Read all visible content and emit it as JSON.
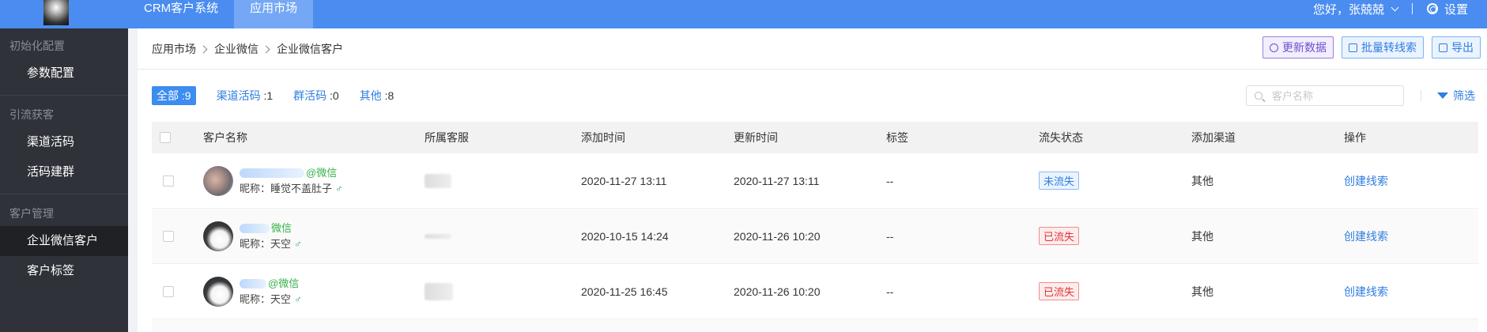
{
  "topbar": {
    "nav": [
      {
        "label": "CRM客户系统",
        "active": false
      },
      {
        "label": "应用市场",
        "active": true
      }
    ],
    "greeting": "您好，张兢兢",
    "settings_label": "设置"
  },
  "sidebar": {
    "groups": [
      {
        "title": "初始化配置",
        "items": [
          {
            "label": "参数配置",
            "active": false
          }
        ]
      },
      {
        "title": "引流获客",
        "items": [
          {
            "label": "渠道活码",
            "active": false
          },
          {
            "label": "活码建群",
            "active": false
          }
        ]
      },
      {
        "title": "客户管理",
        "items": [
          {
            "label": "企业微信客户",
            "active": true
          },
          {
            "label": "客户标签",
            "active": false
          }
        ]
      }
    ]
  },
  "breadcrumb": [
    "应用市场",
    "企业微信",
    "企业微信客户"
  ],
  "header_buttons": {
    "refresh": "更新数据",
    "batch_convert": "批量转线索",
    "export": "导出"
  },
  "tabs": [
    {
      "label": "全部",
      "count": ":9",
      "active": true
    },
    {
      "label": "渠道活码",
      "count": ":1",
      "active": false
    },
    {
      "label": "群活码",
      "count": ":0",
      "active": false
    },
    {
      "label": "其他",
      "count": ":8",
      "active": false
    }
  ],
  "search": {
    "placeholder": "客户名称",
    "value": ""
  },
  "filter_label": "筛选",
  "table": {
    "columns": [
      "客户名称",
      "所属客服",
      "添加时间",
      "更新时间",
      "标签",
      "流失状态",
      "添加渠道",
      "操作"
    ],
    "rows": [
      {
        "name_suffix": "@微信",
        "nickname": "昵称：睡觉不盖肚子",
        "gender": "♂",
        "added": "2020-11-27 13:11",
        "updated": "2020-11-27 13:11",
        "tag": "--",
        "status": "未流失",
        "status_type": "ok",
        "channel": "其他",
        "action": "创建线索"
      },
      {
        "name_suffix": "微信",
        "nickname": "昵称：天空",
        "gender": "♂",
        "added": "2020-10-15 14:24",
        "updated": "2020-11-26 10:20",
        "tag": "--",
        "status": "已流失",
        "status_type": "lost",
        "channel": "其他",
        "action": "创建线索"
      },
      {
        "name_suffix": "@微信",
        "nickname": "昵称：天空",
        "gender": "♂",
        "added": "2020-11-25 16:45",
        "updated": "2020-11-26 10:20",
        "tag": "--",
        "status": "已流失",
        "status_type": "lost",
        "channel": "其他",
        "action": "创建线索"
      }
    ]
  }
}
